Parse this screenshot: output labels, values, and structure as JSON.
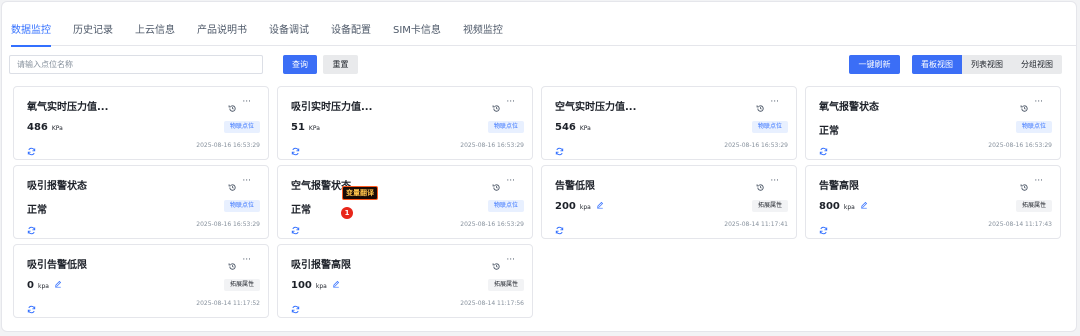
{
  "tabs": [
    "数据监控",
    "历史记录",
    "上云信息",
    "产品说明书",
    "设备调试",
    "设备配置",
    "SIM卡信息",
    "视频监控"
  ],
  "search": {
    "placeholder": "请输入点位名称"
  },
  "toolbar": {
    "query_label": "查询",
    "reset_label": "重置",
    "refresh_all_label": "一键刷新"
  },
  "views": [
    "看板视图",
    "列表视图",
    "分组视图"
  ],
  "cards": [
    {
      "title": "氧气实时压力值...",
      "value": "486",
      "unit": "KPa",
      "tag": "物联点位",
      "time": "2025-08-16 16:53:29"
    },
    {
      "title": "吸引实时压力值...",
      "value": "51",
      "unit": "KPa",
      "tag": "物联点位",
      "time": "2025-08-16 16:53:29"
    },
    {
      "title": "空气实时压力值...",
      "value": "546",
      "unit": "KPa",
      "tag": "物联点位",
      "time": "2025-08-16 16:53:29"
    },
    {
      "title": "氧气报警状态",
      "value": "正常",
      "unit": "",
      "tag": "物联点位",
      "time": "2025-08-16 16:53:29"
    },
    {
      "title": "吸引报警状态",
      "value": "正常",
      "unit": "",
      "tag": "物联点位",
      "time": "2025-08-16 16:53:29"
    },
    {
      "title": "空气报警状态",
      "value": "正常",
      "unit": "",
      "tag": "物联点位",
      "time": "2025-08-16 16:53:29"
    },
    {
      "title": "告警低限",
      "value": "200",
      "unit": "kpa",
      "tag": "拓展属性",
      "time": "2025-08-14 11:17:41"
    },
    {
      "title": "告警高限",
      "value": "800",
      "unit": "kpa",
      "tag": "拓展属性",
      "time": "2025-08-14 11:17:43"
    },
    {
      "title": "吸引告警低限",
      "value": "0",
      "unit": "kpa",
      "tag": "拓展属性",
      "time": "2025-08-14 11:17:52"
    },
    {
      "title": "吸引报警高限",
      "value": "100",
      "unit": "kpa",
      "tag": "拓展属性",
      "time": "2025-08-14 11:17:56"
    }
  ],
  "overlay": {
    "translate_label": "变量翻译",
    "badge_count": "1"
  },
  "colors": {
    "primary": "#3b6ef6",
    "tag_blue_bg": "#e8f0ff",
    "tag_blue_text": "#3370ff",
    "tag_gray_bg": "#f2f3f5",
    "badge_red": "#e8261a"
  }
}
